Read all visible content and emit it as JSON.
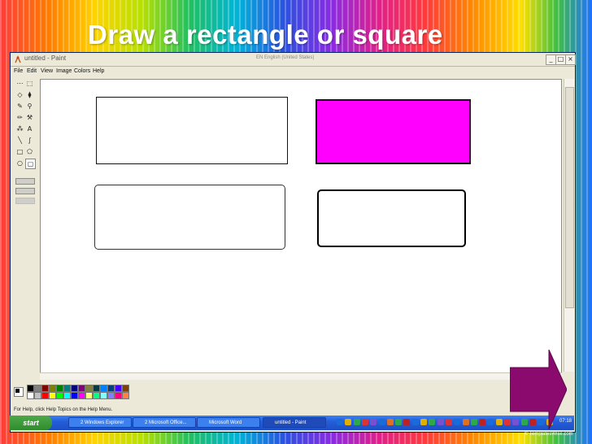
{
  "slide": {
    "title": "Draw a rectangle or square",
    "credit": "© TemplatesWise.com"
  },
  "window": {
    "title": "untitled - Paint",
    "language_bar": "EN English (United States)",
    "buttons": {
      "minimize": "_",
      "maximize": "□",
      "close": "×"
    }
  },
  "menu": [
    "File",
    "Edit",
    "View",
    "Image",
    "Colors",
    "Help"
  ],
  "tools": [
    {
      "name": "free-select",
      "glyph": "⋯"
    },
    {
      "name": "rect-select",
      "glyph": "⬚"
    },
    {
      "name": "eraser",
      "glyph": "◇"
    },
    {
      "name": "fill",
      "glyph": "⧫"
    },
    {
      "name": "color-picker",
      "glyph": "✎"
    },
    {
      "name": "magnifier",
      "glyph": "⚲"
    },
    {
      "name": "pencil",
      "glyph": "✏"
    },
    {
      "name": "brush",
      "glyph": "⚒"
    },
    {
      "name": "airbrush",
      "glyph": "⁂"
    },
    {
      "name": "text",
      "glyph": "A"
    },
    {
      "name": "line",
      "glyph": "╲"
    },
    {
      "name": "curve",
      "glyph": "∫"
    },
    {
      "name": "rectangle",
      "glyph": "□"
    },
    {
      "name": "polygon",
      "glyph": "⬠"
    },
    {
      "name": "ellipse",
      "glyph": "○"
    },
    {
      "name": "rounded-rectangle",
      "glyph": "▢"
    }
  ],
  "palette": {
    "foreground": "#000000",
    "background": "#ffffff",
    "colors_top": [
      "#000000",
      "#808080",
      "#800000",
      "#808000",
      "#008000",
      "#008080",
      "#000080",
      "#800080",
      "#808040",
      "#004040",
      "#0080ff",
      "#004080",
      "#4000ff",
      "#804000"
    ],
    "colors_bottom": [
      "#ffffff",
      "#c0c0c0",
      "#ff0000",
      "#ffff00",
      "#00ff00",
      "#00ffff",
      "#0000ff",
      "#ff00ff",
      "#ffff80",
      "#00ff80",
      "#80ffff",
      "#8080ff",
      "#ff0080",
      "#ff8040"
    ]
  },
  "canvas": {
    "magenta_fill": "#ff00ff"
  },
  "status_text": "For Help, click Help Topics on the Help Menu.",
  "taskbar": {
    "start_label": "start",
    "tasks": [
      "2 Windows Explorer",
      "2 Microsoft Office...",
      "Microsoft Word",
      "untitled - Paint"
    ],
    "clock": "07:18"
  },
  "colors": {
    "next_arrow": "#8b0a6e"
  }
}
